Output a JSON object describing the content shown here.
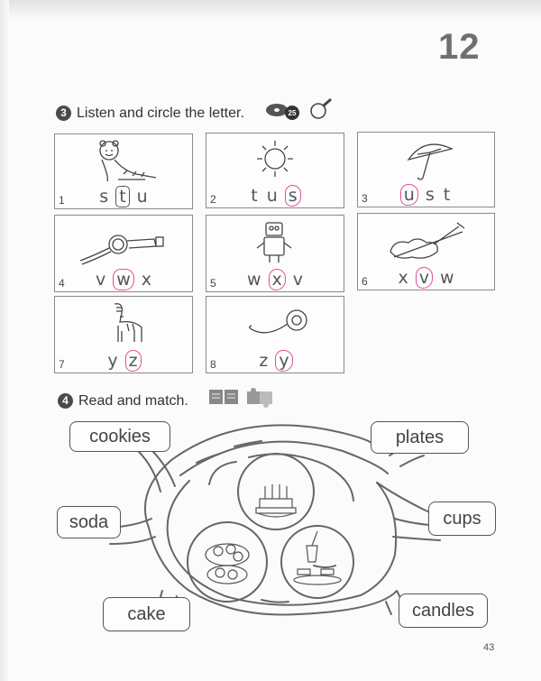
{
  "page": {
    "number": "12",
    "footer": "43"
  },
  "exercise3": {
    "num": "3",
    "instruction": "Listen and circle the letter.",
    "track": "25",
    "cards": [
      {
        "num": "1",
        "picture": "tiger-icon",
        "letters": [
          "s",
          "t",
          "u"
        ],
        "circled": 1,
        "mark": "box"
      },
      {
        "num": "2",
        "picture": "sun-icon",
        "letters": [
          "t",
          "u",
          "s"
        ],
        "circled": 2,
        "mark": "pink"
      },
      {
        "num": "3",
        "picture": "umbrella-icon",
        "letters": [
          "u",
          "s",
          "t"
        ],
        "circled": 0,
        "mark": "pink"
      },
      {
        "num": "4",
        "picture": "watch-icon",
        "letters": [
          "v",
          "w",
          "x"
        ],
        "circled": 1,
        "mark": "pink"
      },
      {
        "num": "5",
        "picture": "robot-icon",
        "letters": [
          "w",
          "x",
          "v"
        ],
        "circled": 1,
        "mark": "pink"
      },
      {
        "num": "6",
        "picture": "violin-icon",
        "letters": [
          "x",
          "v",
          "w"
        ],
        "circled": 1,
        "mark": "pink"
      },
      {
        "num": "7",
        "picture": "zebra-icon",
        "letters": [
          "y",
          "z"
        ],
        "circled": 1,
        "mark": "pink"
      },
      {
        "num": "8",
        "picture": "yoyo-icon",
        "letters": [
          "z",
          "y"
        ],
        "circled": 1,
        "mark": "pink"
      }
    ]
  },
  "exercise4": {
    "num": "4",
    "instruction": "Read and match.",
    "words": {
      "cookies": "cookies",
      "plates": "plates",
      "soda": "soda",
      "cups": "cups",
      "cake": "cake",
      "candles": "candles"
    }
  }
}
